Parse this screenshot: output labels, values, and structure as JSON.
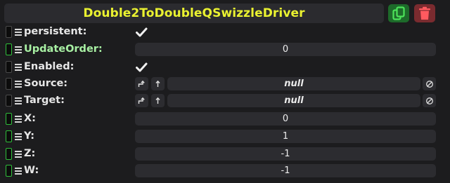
{
  "component": {
    "title": "Double2ToDoubleQSwizzleDriver",
    "duplicate_icon": "duplicate-icon",
    "delete_icon": "trash-icon"
  },
  "fields": [
    {
      "label": "persistent:",
      "kind": "bool",
      "checked": true
    },
    {
      "label": "UpdateOrder:",
      "kind": "number",
      "value": "0"
    },
    {
      "label": "Enabled:",
      "kind": "bool",
      "checked": true
    },
    {
      "label": "Source:",
      "kind": "ref",
      "value": "null"
    },
    {
      "label": "Target:",
      "kind": "ref",
      "value": "null"
    },
    {
      "label": "X:",
      "kind": "number",
      "value": "0"
    },
    {
      "label": "Y:",
      "kind": "number",
      "value": "1"
    },
    {
      "label": "Z:",
      "kind": "number",
      "value": "-1"
    },
    {
      "label": "W:",
      "kind": "number",
      "value": "-1"
    }
  ],
  "colors": {
    "title": "#eaf230",
    "green_label": "#a8f0a3",
    "handle_green": "#2fbf3a",
    "duplicate_button": "#1d6a2a",
    "delete_button": "#7a2b2f"
  }
}
